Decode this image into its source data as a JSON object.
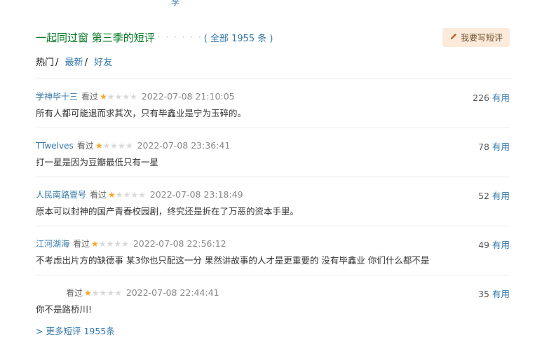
{
  "top_fragment": "李",
  "header": {
    "title": "一起同过窗 第三季的短评",
    "dots": "· · · · · ·",
    "total": "( 全部 1955 条 )",
    "write_button": "我要写短评",
    "write_icon": "pencil-icon",
    "accent_color": "#007722",
    "link_color": "#3377aa"
  },
  "tabs": [
    {
      "label": "热门",
      "active": true
    },
    {
      "label": "最新",
      "active": false
    },
    {
      "label": "好友",
      "active": false
    }
  ],
  "tab_separator": "/",
  "watched_label": "看过",
  "useful_label": "有用",
  "comments": [
    {
      "user": "学神毕十三",
      "rating": 1,
      "time": "2022-07-08 21:10:05",
      "useful": "226",
      "content": "所有人都可能退而求其次，只有毕鑫业是宁为玉碎的。"
    },
    {
      "user": "TTwelves",
      "rating": 1,
      "time": "2022-07-08 23:36:41",
      "useful": "78",
      "content": "打一星是因为豆瓣最低只有一星"
    },
    {
      "user": "人民南路壹号",
      "rating": 1,
      "time": "2022-07-08 23:18:49",
      "useful": "52",
      "content": "原本可以封神的国产青春校园剧，终究还是折在了万恶的资本手里。"
    },
    {
      "user": "江河湖海",
      "rating": 1,
      "time": "2022-07-08 22:56:12",
      "useful": "49",
      "content": "不考虑出片方的缺德事 某3你也只配这一分 果然讲故事的人才是更重要的 没有毕鑫业 你们什么都不是"
    },
    {
      "user": "",
      "rating": 1,
      "time": "2022-07-08 22:44:41",
      "useful": "35",
      "content": "你不是路桥川!"
    }
  ],
  "more_link": {
    "arrow": ">",
    "label": "更多短评 1955条"
  }
}
